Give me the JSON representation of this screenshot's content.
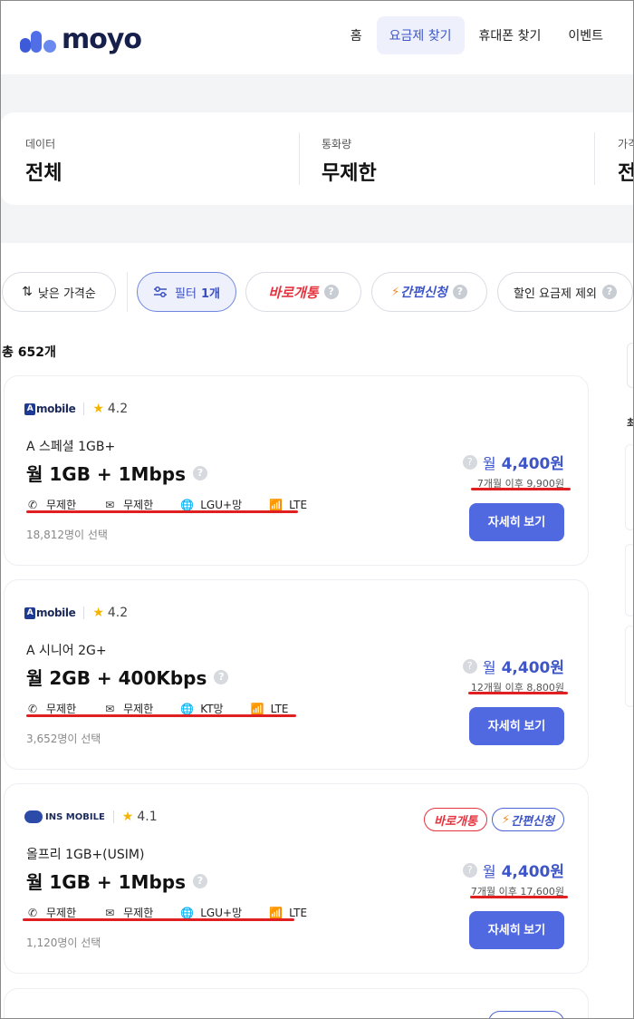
{
  "header": {
    "logo_text": "moyo",
    "nav": [
      "홈",
      "요금제 찾기",
      "휴대폰 찾기",
      "이벤트"
    ]
  },
  "summary": [
    {
      "label": "데이터",
      "value": "전체"
    },
    {
      "label": "통화량",
      "value": "무제한"
    },
    {
      "label": "가격",
      "value": "전"
    }
  ],
  "chips": {
    "sort": "낮은 가격순",
    "filter": "필터",
    "filter_count": "1개",
    "instant": "바로개통",
    "easy": "간편신청",
    "exclude_discount": "할인 요금제 제외"
  },
  "total": "총 652개",
  "side": {
    "label": "최"
  },
  "cards": [
    {
      "carrier": "mobile",
      "rating": "4.2",
      "plan_name": "A 스페셜 1GB+",
      "plan_title": "월 1GB + 1Mbps",
      "features": [
        "무제한",
        "무제한",
        "LGU+망",
        "LTE"
      ],
      "selected": "18,812명이 선택",
      "price_prefix": "월",
      "price": "4,400원",
      "after": "7개월 이후 9,900원",
      "button": "자세히 보기",
      "tags": []
    },
    {
      "carrier": "mobile",
      "rating": "4.2",
      "plan_name": "A 시니어 2G+",
      "plan_title": "월 2GB + 400Kbps",
      "features": [
        "무제한",
        "무제한",
        "KT망",
        "LTE"
      ],
      "selected": "3,652명이 선택",
      "price_prefix": "월",
      "price": "4,400원",
      "after": "12개월 이후 8,800원",
      "button": "자세히 보기",
      "tags": []
    },
    {
      "carrier": "INS MOBILE",
      "rating": "4.1",
      "plan_name": "올프리 1GB+(USIM)",
      "plan_title": "월 1GB + 1Mbps",
      "features": [
        "무제한",
        "무제한",
        "LGU+망",
        "LTE"
      ],
      "selected": "1,120명이 선택",
      "price_prefix": "월",
      "price": "4,400원",
      "after": "7개월 이후 17,600원",
      "button": "자세히 보기",
      "tags": [
        "바로개통",
        "간편신청"
      ]
    }
  ],
  "colors": {
    "accent": "#5169e0",
    "price": "#3e55c7",
    "highlight": "#e02020",
    "instant": "#e5343f"
  }
}
